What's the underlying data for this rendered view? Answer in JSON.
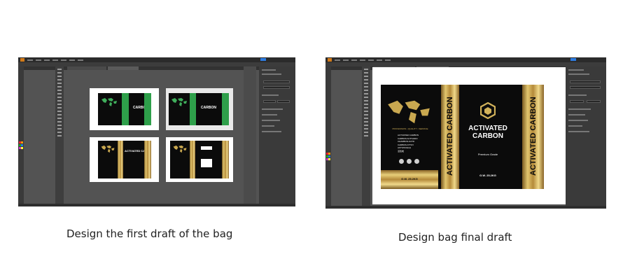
{
  "captions": {
    "first_draft": "Design the first draft of the bag",
    "final_draft": "Design bag final draft"
  },
  "bag": {
    "brand_line1": "ACTIVATED",
    "brand_line2": "CARBON",
    "brand_full": "ACTIVATED CARBON",
    "short_name": "CARBON",
    "tagline": "PROFESSION • QUALITY • SERVICE",
    "grade": "Premium Grade",
    "weight": "G.W. 25.2KG",
    "features": [
      "ACTIVATED CARBON",
      "CARBON ACTIVADO",
      "CHARBON ACTIF",
      "CARBON ATTIVI",
      "AKTIVKOHLE",
      "活性炭"
    ]
  },
  "colors": {
    "workspace": "#535353",
    "artboard_bg": "#e9e9e9",
    "green_accent": "#2e9f4a",
    "gold_accent": "#d2b25a",
    "bag_black": "#0b0b0b",
    "app_blue": "#2d7be0"
  },
  "icons": {
    "map": "world-map-icon",
    "logo": "hexagon-logo-icon",
    "badges": "certification-badge-icon"
  }
}
